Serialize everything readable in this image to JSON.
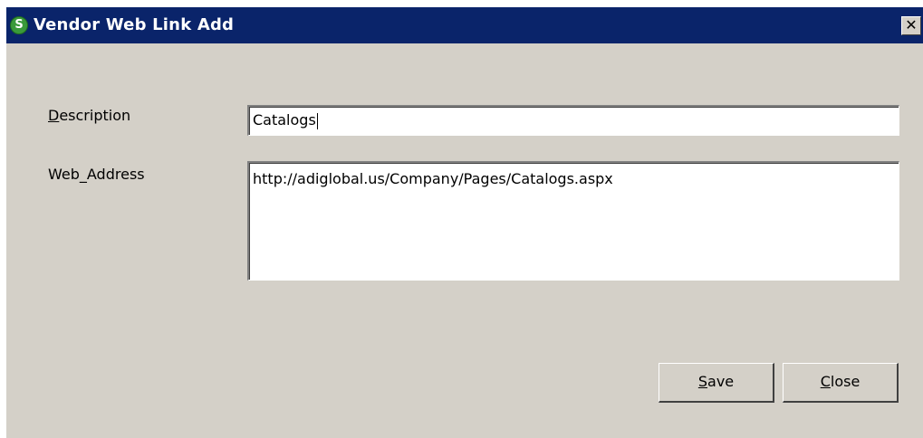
{
  "window": {
    "title": "Vendor Web Link Add",
    "app_icon_letter": "S",
    "close_glyph": "✕"
  },
  "form": {
    "description": {
      "label_mnemonic": "D",
      "label_rest": "escription",
      "value": "Catalogs"
    },
    "web_address": {
      "label_pre": "Web",
      "label_mnemonic": "_",
      "label_rest": "Address",
      "value": "http://adiglobal.us/Company/Pages/Catalogs.aspx"
    }
  },
  "buttons": {
    "save": {
      "mnemonic": "S",
      "rest": "ave"
    },
    "close": {
      "mnemonic": "C",
      "rest": "lose"
    }
  },
  "colors": {
    "titlebar": "#0a246a",
    "window_bg": "#d4d0c8",
    "app_icon": "#3a9a3a"
  }
}
